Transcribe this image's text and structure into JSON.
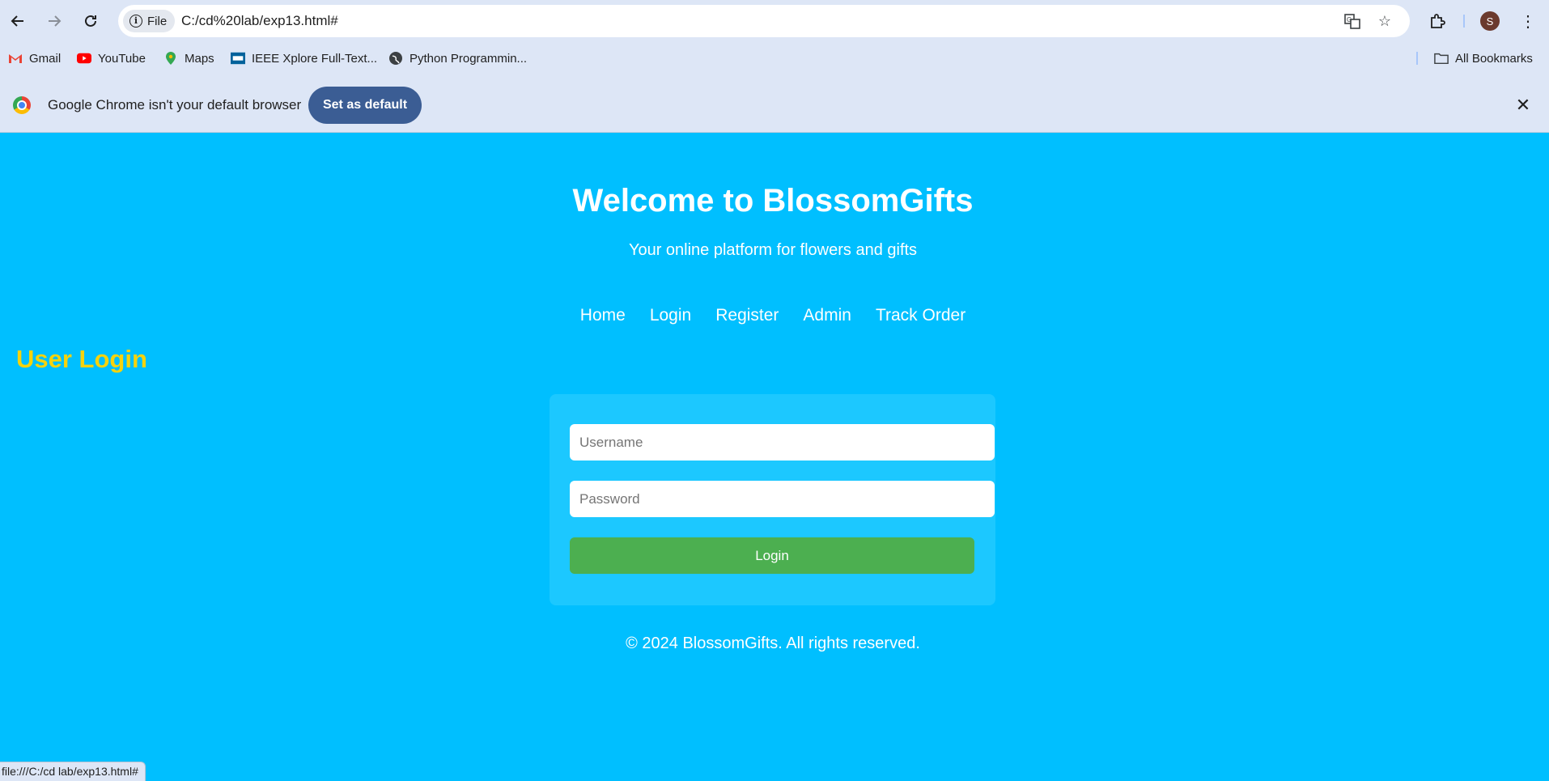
{
  "browser": {
    "address_chip": "File",
    "url": "C:/cd%20lab/exp13.html#",
    "profile_initial": "S",
    "status_url": "file:///C:/cd lab/exp13.html#"
  },
  "bookmarks": {
    "items": [
      {
        "label": "Gmail",
        "icon": "gmail-icon"
      },
      {
        "label": "YouTube",
        "icon": "youtube-icon"
      },
      {
        "label": "Maps",
        "icon": "maps-icon"
      },
      {
        "label": "IEEE Xplore Full-Text...",
        "icon": "ieee-icon"
      },
      {
        "label": "Python Programmin...",
        "icon": "globe-icon"
      }
    ],
    "all_bookmarks": "All Bookmarks"
  },
  "infobar": {
    "message": "Google Chrome isn't your default browser",
    "button": "Set as default"
  },
  "page": {
    "title": "Welcome to BlossomGifts",
    "subtitle": "Your online platform for flowers and gifts",
    "nav": [
      "Home",
      "Login",
      "Register",
      "Admin",
      "Track Order"
    ],
    "section_title": "User Login",
    "form": {
      "username_placeholder": "Username",
      "password_placeholder": "Password",
      "submit_label": "Login"
    },
    "footer": "© 2024 BlossomGifts. All rights reserved."
  },
  "colors": {
    "page_background": "#00bfff",
    "card_background": "#1cc8ff",
    "section_title": "#f5d30c",
    "login_button": "#4caf50",
    "set_default_button": "#3b5d94"
  }
}
